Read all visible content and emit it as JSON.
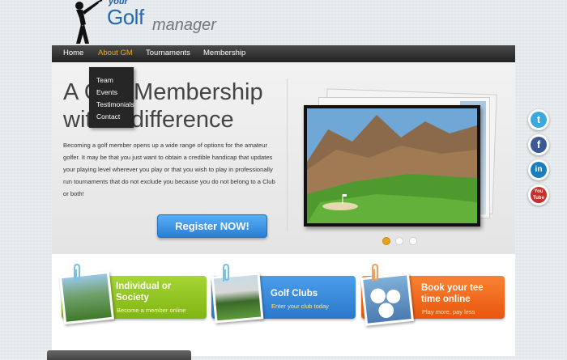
{
  "logo": {
    "your": "your",
    "golf": "Golf",
    "manager": "manager"
  },
  "nav": {
    "items": [
      "Home",
      "About GM",
      "Tournaments",
      "Membership"
    ],
    "active": "About GM"
  },
  "dropdown": {
    "items": [
      "Team",
      "Events",
      "Testimonials",
      "Contact"
    ]
  },
  "hero": {
    "headline_line1": "A Golf Membership",
    "headline_line2": "with a difference",
    "body": "Becoming a golf member opens up a wide range of options for the amateur golfer. It may be that you just want to obtain a credible handicap that updates your playing level wherever you play or that you wish to play in professionally run tournaments that do not exclude you because you do not belong to a Club or both!",
    "register_label": "Register NOW!"
  },
  "slider": {
    "dots": 3,
    "active_index": 0
  },
  "social": [
    "twitter-icon",
    "facebook-icon",
    "linkedin-icon",
    "youtube-icon"
  ],
  "social_labels": {
    "twitter": "t",
    "facebook": "f",
    "linkedin": "in",
    "youtube": "You\nTube"
  },
  "promos": [
    {
      "title": "Individual or Society",
      "subtitle": "Become a member online",
      "color": "#8fc41e"
    },
    {
      "title": "Golf Clubs",
      "subtitle": "Enter your club today",
      "color": "#2d83d8"
    },
    {
      "title": "Book your tee time online",
      "subtitle": "Play more, pay less",
      "color": "#f0651a"
    }
  ],
  "colors": {
    "accent": "#f0a81e",
    "nav_bg": "#2a2a2a",
    "register": "#2a7fd4"
  }
}
